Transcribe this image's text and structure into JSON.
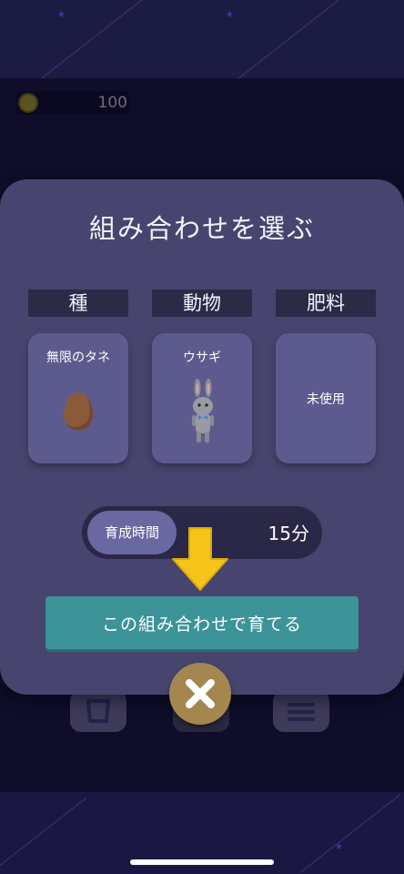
{
  "header": {
    "coin_count": "100"
  },
  "dialog": {
    "title": "組み合わせを選ぶ",
    "columns": [
      {
        "header": "種",
        "value": "無限のタネ",
        "icon": "egg-seed-icon"
      },
      {
        "header": "動物",
        "value": "ウサギ",
        "icon": "rabbit-icon"
      },
      {
        "header": "肥料",
        "value": "未使用",
        "icon": ""
      }
    ],
    "growth_time_label": "育成時間",
    "growth_time_value": "15分",
    "grow_button_label": "この組み合わせで育てる",
    "close_icon": "close-icon"
  },
  "colors": {
    "dialog_bg": "#47456f",
    "card_bg": "#5d5b8e",
    "button_teal": "#3c9499",
    "close_gold": "#a3874e",
    "arrow_yellow": "#f5c418"
  }
}
